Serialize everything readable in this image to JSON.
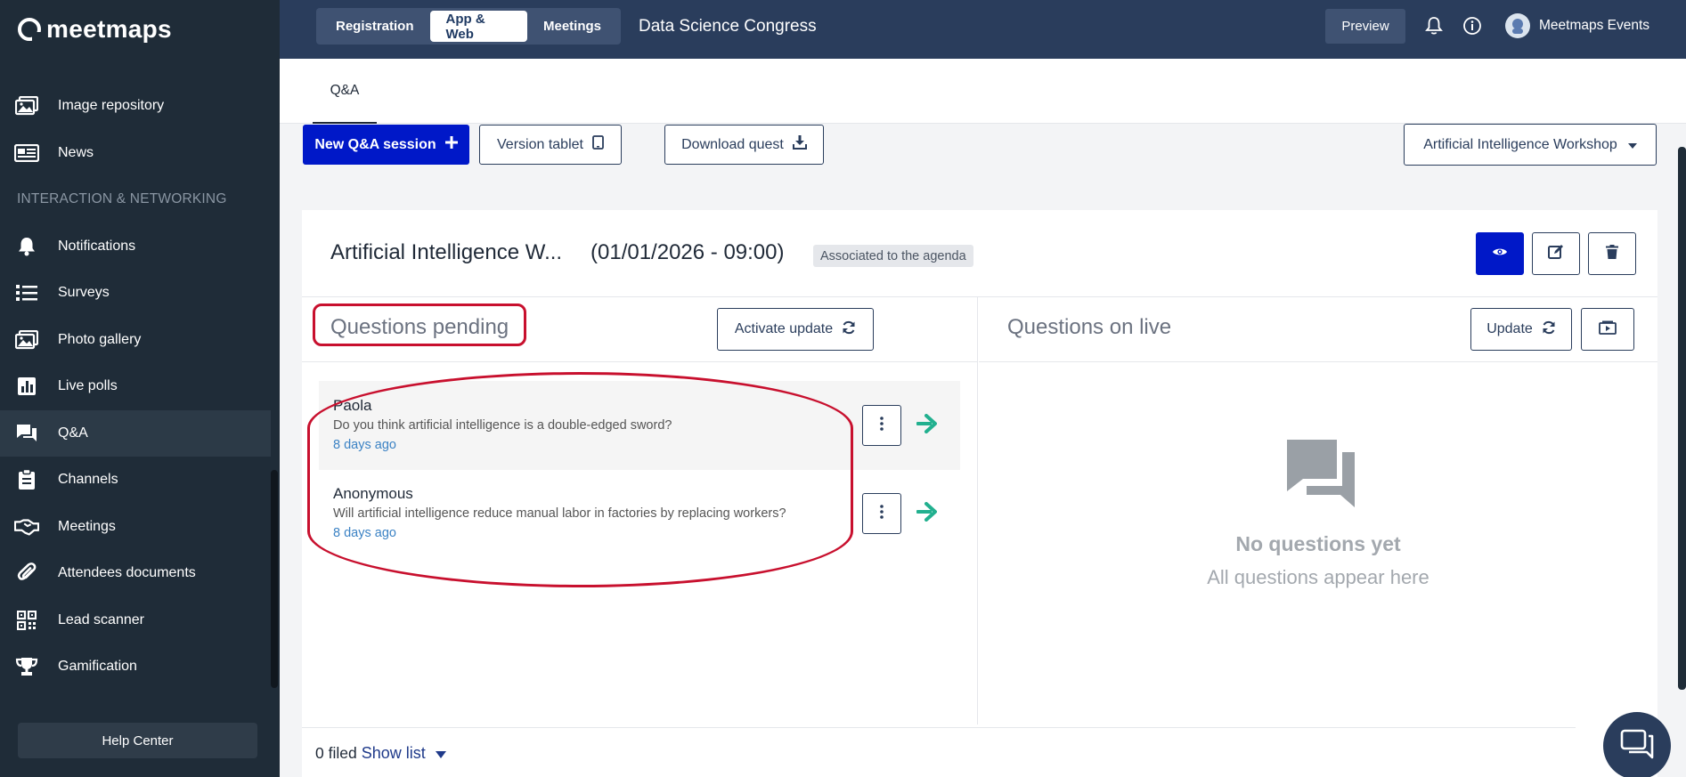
{
  "app": {
    "logo_text": "meetmaps"
  },
  "sidebar": {
    "items_top": [
      {
        "label": "Image repository",
        "icon": "images-icon"
      },
      {
        "label": "News",
        "icon": "newspaper-icon"
      }
    ],
    "section_title": "INTERACTION & NETWORKING",
    "items": [
      {
        "label": "Notifications",
        "icon": "bell-icon"
      },
      {
        "label": "Surveys",
        "icon": "list-icon"
      },
      {
        "label": "Photo gallery",
        "icon": "images-icon"
      },
      {
        "label": "Live polls",
        "icon": "bar-chart-icon"
      },
      {
        "label": "Q&A",
        "icon": "comments-icon",
        "active": true
      },
      {
        "label": "Channels",
        "icon": "clipboard-icon"
      },
      {
        "label": "Meetings",
        "icon": "handshake-icon"
      },
      {
        "label": "Attendees documents",
        "icon": "paperclip-icon"
      },
      {
        "label": "Lead scanner",
        "icon": "qr-code-icon"
      },
      {
        "label": "Gamification",
        "icon": "trophy-icon"
      }
    ],
    "help_label": "Help Center"
  },
  "topbar": {
    "tabs": [
      {
        "label": "Registration",
        "active": false
      },
      {
        "label": "App & Web",
        "active": true
      },
      {
        "label": "Meetings",
        "active": false
      }
    ],
    "event_title": "Data Science Congress",
    "preview_label": "Preview",
    "user_name": "Meetmaps Events"
  },
  "page": {
    "tab_label": "Q&A",
    "new_session_label": "New Q&A session",
    "version_tablet_label": "Version tablet",
    "download_label": "Download quest",
    "session_select": "Artificial Intelligence Workshop"
  },
  "session": {
    "title": "Artificial Intelligence W...",
    "date": "(01/01/2026 - 09:00)",
    "badge": "Associated to the agenda"
  },
  "pending": {
    "title": "Questions pending",
    "activate_label": "Activate update",
    "questions": [
      {
        "name": "Paola",
        "text": "Do you think artificial intelligence is a double-edged sword?",
        "time": "8 days ago"
      },
      {
        "name": "Anonymous",
        "text": "Will artificial intelligence reduce manual labor in factories by replacing workers?",
        "time": "8 days ago"
      }
    ]
  },
  "live": {
    "title": "Questions on live",
    "update_label": "Update",
    "empty_title": "No questions yet",
    "empty_subtitle": "All questions appear here"
  },
  "footer": {
    "filed_text": "0 filed",
    "show_list_label": "Show list"
  },
  "colors": {
    "sidebar_bg": "#1f2c38",
    "topbar_bg": "#2a3d5c",
    "primary": "#0018c8",
    "accent_green": "#22b08f",
    "highlight_red": "#c8102e"
  }
}
